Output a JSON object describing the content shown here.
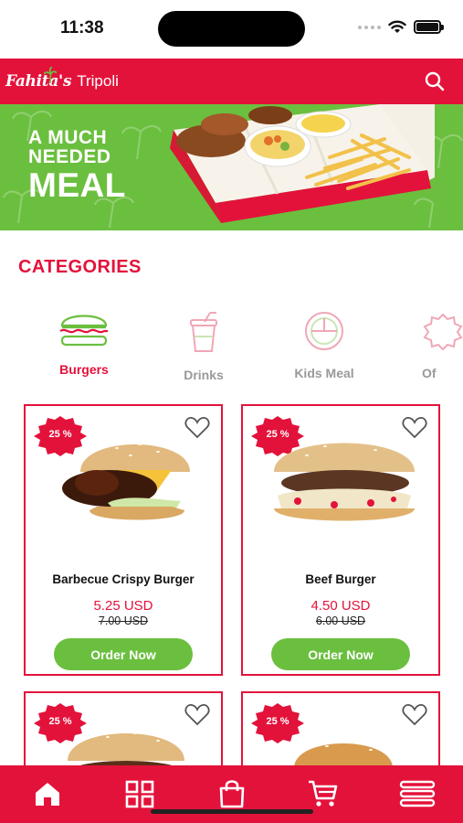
{
  "status_bar": {
    "time": "11:38"
  },
  "header": {
    "logo_text": "Fahita's",
    "city": "Tripoli"
  },
  "banner": {
    "line1": "A MUCH",
    "line2": "NEEDED",
    "line3": "MEAL"
  },
  "categories": {
    "title": "CATEGORIES",
    "items": [
      {
        "label": "Burgers",
        "icon": "burger-icon",
        "active": true
      },
      {
        "label": "Drinks",
        "icon": "drink-icon",
        "active": false
      },
      {
        "label": "Kids Meal",
        "icon": "kids-meal-icon",
        "active": false
      },
      {
        "label": "Of",
        "icon": "offers-icon",
        "active": false
      }
    ]
  },
  "products": [
    {
      "name": "Barbecue Crispy Burger",
      "price": "5.25 USD",
      "old_price": "7.00 USD",
      "discount": "25 %",
      "button": "Order Now"
    },
    {
      "name": "Beef Burger",
      "price": "4.50 USD",
      "old_price": "6.00 USD",
      "discount": "25 %",
      "button": "Order Now"
    },
    {
      "discount": "25 %"
    },
    {
      "discount": "25 %"
    }
  ],
  "bottom_nav": {
    "items": [
      "home-icon",
      "grid-icon",
      "bag-icon",
      "cart-icon",
      "menu-icon"
    ]
  },
  "colors": {
    "brand_red": "#e3123b",
    "accent_green": "#6bbf3f"
  }
}
